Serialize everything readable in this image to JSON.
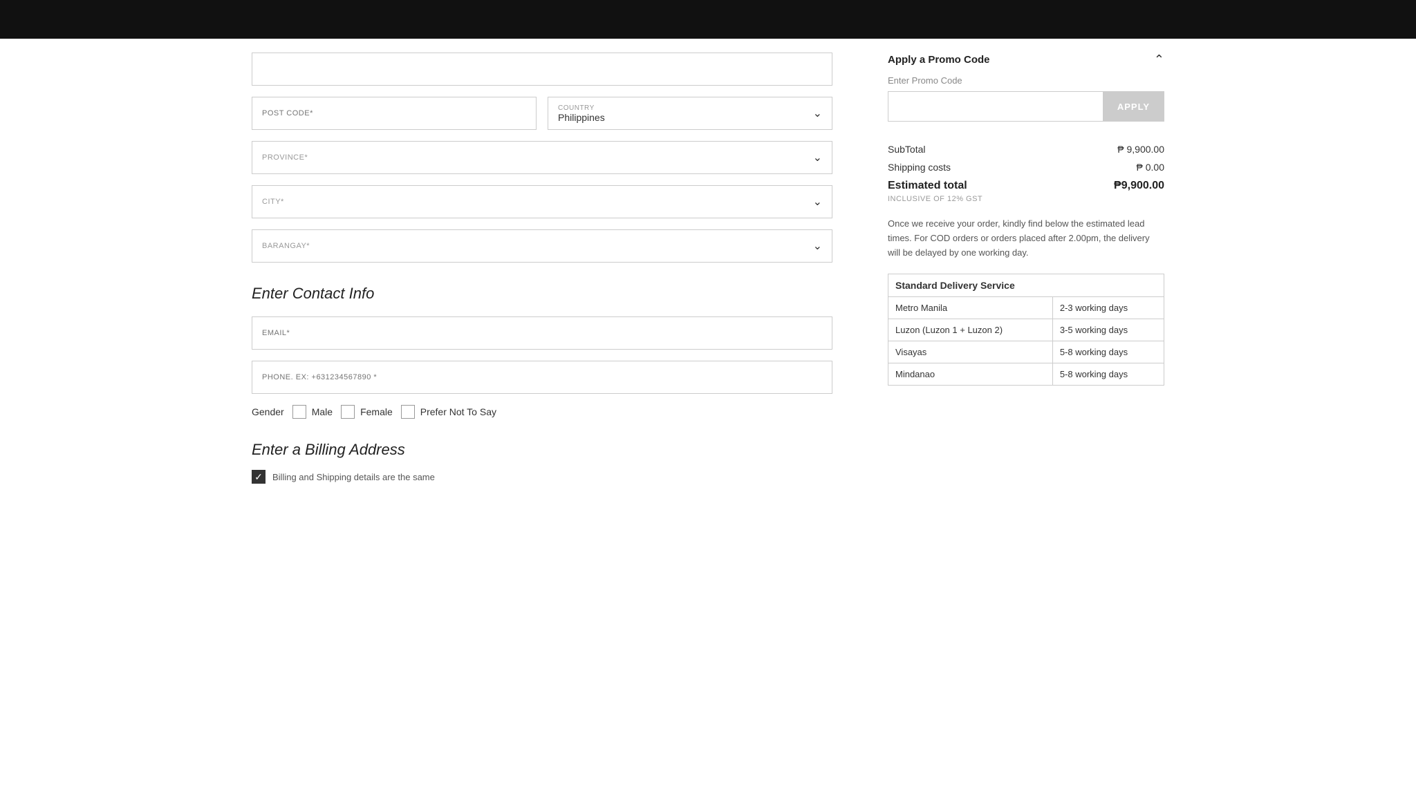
{
  "topBar": {
    "background": "#111"
  },
  "leftColumn": {
    "placeholderField": "",
    "postCode": {
      "label": "POST CODE*",
      "placeholder": "POST CODE*"
    },
    "country": {
      "label": "COUNTRY",
      "value": "Philippines"
    },
    "province": {
      "label": "PROVINCE*"
    },
    "city": {
      "label": "CITY*"
    },
    "barangay": {
      "label": "BARANGAY*"
    },
    "contactSection": {
      "title": "Enter Contact Info"
    },
    "email": {
      "placeholder": "EMAIL*"
    },
    "phone": {
      "placeholder": "PHONE. EX: +631234567890 *"
    },
    "gender": {
      "label": "Gender",
      "options": [
        "Male",
        "Female",
        "Prefer Not To Say"
      ]
    },
    "billingSection": {
      "title": "Enter a Billing Address"
    },
    "billingOption": {
      "label": "Billing and Shipping details are the same"
    }
  },
  "rightColumn": {
    "promoSection": {
      "title": "Apply a Promo Code",
      "label": "Enter Promo Code",
      "inputPlaceholder": "",
      "applyLabel": "APPLY"
    },
    "subtotal": {
      "label": "SubTotal",
      "value": "₱ 9,900.00"
    },
    "shipping": {
      "label": "Shipping costs",
      "value": "₱ 0.00"
    },
    "total": {
      "label": "Estimated total",
      "value": "₱9,900.00"
    },
    "gstNote": "INCLUSIVE OF 12% GST",
    "leadTimeNote": "Once we receive your order, kindly find below the estimated lead times. For COD orders or orders placed after 2.00pm, the delivery will be delayed by one working day.",
    "deliveryTable": {
      "header": "Standard Delivery Service",
      "rows": [
        {
          "region": "Metro Manila",
          "time": "2-3 working days"
        },
        {
          "region": "Luzon (Luzon 1 + Luzon 2)",
          "time": "3-5 working days"
        },
        {
          "region": "Visayas",
          "time": "5-8 working days"
        },
        {
          "region": "Mindanao",
          "time": "5-8 working days"
        }
      ]
    }
  }
}
